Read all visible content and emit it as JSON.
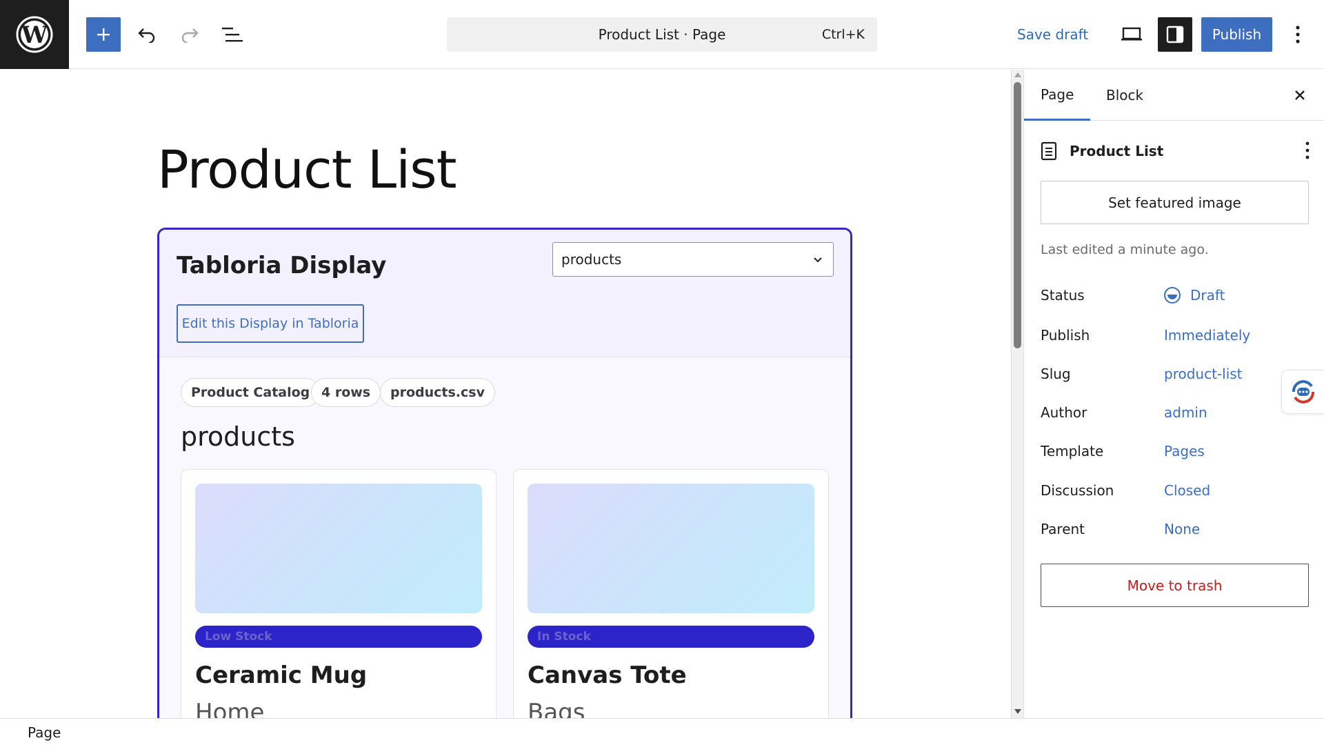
{
  "topbar": {
    "document_title": "Product List · Page",
    "shortcut": "Ctrl+K",
    "save_draft": "Save draft",
    "publish": "Publish"
  },
  "canvas": {
    "page_title": "Product List",
    "block": {
      "heading": "Tabloria Display",
      "select_value": "products",
      "edit_button": "Edit this Display in Tabloria",
      "chips": [
        "Product Catalog",
        "4 rows",
        "products.csv"
      ],
      "subtitle": "products",
      "cards": [
        {
          "badge": "Low Stock",
          "name": "Ceramic Mug",
          "category": "Home"
        },
        {
          "badge": "In Stock",
          "name": "Canvas Tote",
          "category": "Bags"
        }
      ]
    }
  },
  "sidebar": {
    "tabs": [
      "Page",
      "Block"
    ],
    "doc_title": "Product List",
    "featured_image_button": "Set featured image",
    "last_edited": "Last edited a minute ago.",
    "meta": [
      {
        "label": "Status",
        "value": "Draft"
      },
      {
        "label": "Publish",
        "value": "Immediately"
      },
      {
        "label": "Slug",
        "value": "product-list"
      },
      {
        "label": "Author",
        "value": "admin"
      },
      {
        "label": "Template",
        "value": "Pages"
      },
      {
        "label": "Discussion",
        "value": "Closed"
      },
      {
        "label": "Parent",
        "value": "None"
      }
    ],
    "trash_button": "Move to trash"
  },
  "footer": {
    "breadcrumb": "Page"
  },
  "colors": {
    "accent": "#3d6ec0",
    "block_border": "#3a24c8",
    "badge": "#2c24c8",
    "danger": "#cc1818"
  },
  "icons": [
    "wordpress-logo-icon",
    "plus-icon",
    "undo-icon",
    "redo-icon",
    "list-view-icon",
    "desktop-view-icon",
    "sidebar-icon",
    "more-vertical-icon",
    "close-icon",
    "document-icon",
    "chevron-down-icon",
    "draft-status-icon",
    "chat-widget-icon"
  ]
}
